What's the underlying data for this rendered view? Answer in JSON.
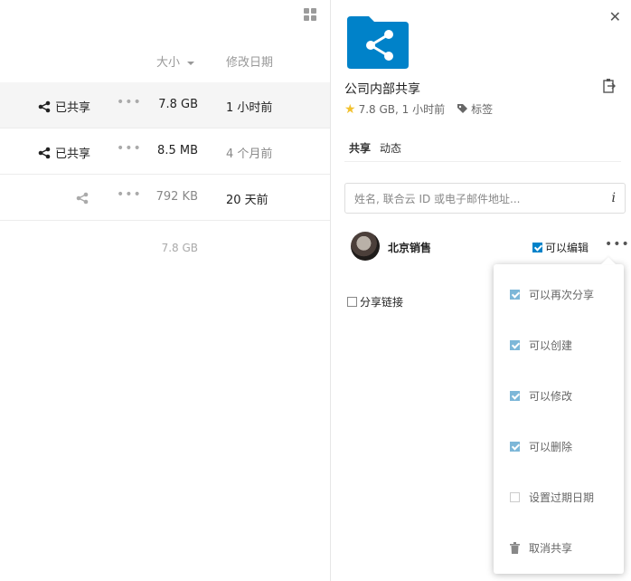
{
  "file_list": {
    "header": {
      "size_label": "大小",
      "date_label": "修改日期"
    },
    "rows": [
      {
        "share_label": "已共享",
        "size": "7.8 GB",
        "date": "1 小时前",
        "selected": true
      },
      {
        "share_label": "已共享",
        "size": "8.5 MB",
        "date": "4 个月前",
        "selected": false
      },
      {
        "share_label": "",
        "size": "792 KB",
        "date": "20 天前",
        "selected": false
      }
    ],
    "total_size": "7.8 GB"
  },
  "sidebar": {
    "file_name": "公司内部共享",
    "size_modified": "7.8 GB, 1 小时前",
    "tags_label": "标签",
    "tabs": [
      {
        "label": "共享"
      },
      {
        "label": "动态"
      }
    ],
    "search_placeholder": "姓名, 联合云 ID 或电子邮件地址...",
    "info_glyph": "i",
    "share_entry": {
      "name": "北京销售",
      "can_edit_label": "可以编辑"
    },
    "share_link_label": "分享链接"
  },
  "menu": {
    "items": [
      {
        "label": "可以再次分享",
        "checked": true
      },
      {
        "label": "可以创建",
        "checked": true
      },
      {
        "label": "可以修改",
        "checked": true
      },
      {
        "label": "可以删除",
        "checked": true
      },
      {
        "label": "设置过期日期",
        "checked": false
      }
    ],
    "unshare_label": "取消共享"
  },
  "colors": {
    "accent": "#0082c9",
    "star": "#f2c12e"
  },
  "icons": [
    "grid-view-icon",
    "share-icon",
    "more-icon",
    "close-icon",
    "folder-shared-icon",
    "clipboard-icon",
    "star-icon",
    "tag-icon",
    "info-icon",
    "trash-icon"
  ]
}
